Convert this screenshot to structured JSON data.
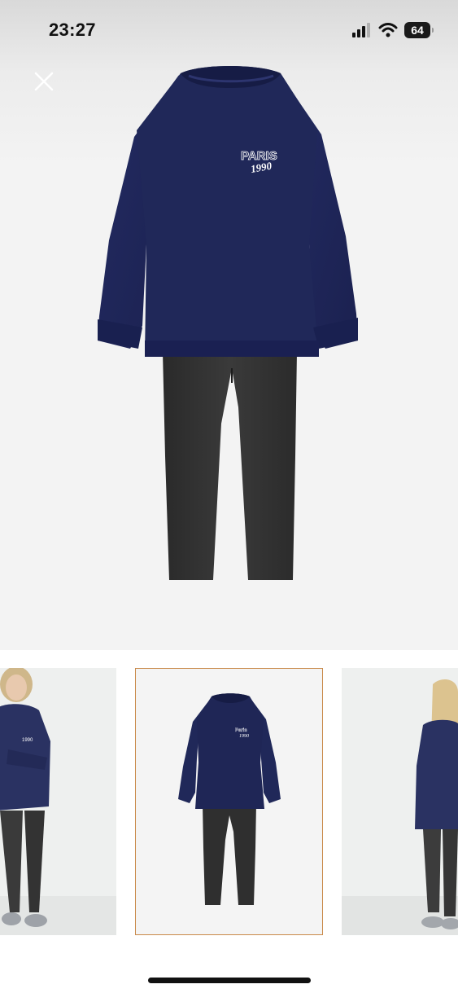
{
  "status_bar": {
    "time": "23:27",
    "battery_level": "64",
    "icons": [
      "cellular-signal-icon",
      "wifi-icon",
      "battery-icon"
    ]
  },
  "hero": {
    "print_line1": "PARIS",
    "print_line2": "1990"
  },
  "gallery": {
    "thumbnails": [
      {
        "name": "model-front-thumbnail",
        "selected": false
      },
      {
        "name": "product-flat-thumbnail",
        "selected": true
      },
      {
        "name": "model-side-thumbnail",
        "selected": false
      }
    ],
    "selected_border_color": "#c98a4a"
  },
  "colors": {
    "sweatshirt": "#1f2656",
    "leggings": "#2e2e2e",
    "background": "#f3f3f3"
  }
}
